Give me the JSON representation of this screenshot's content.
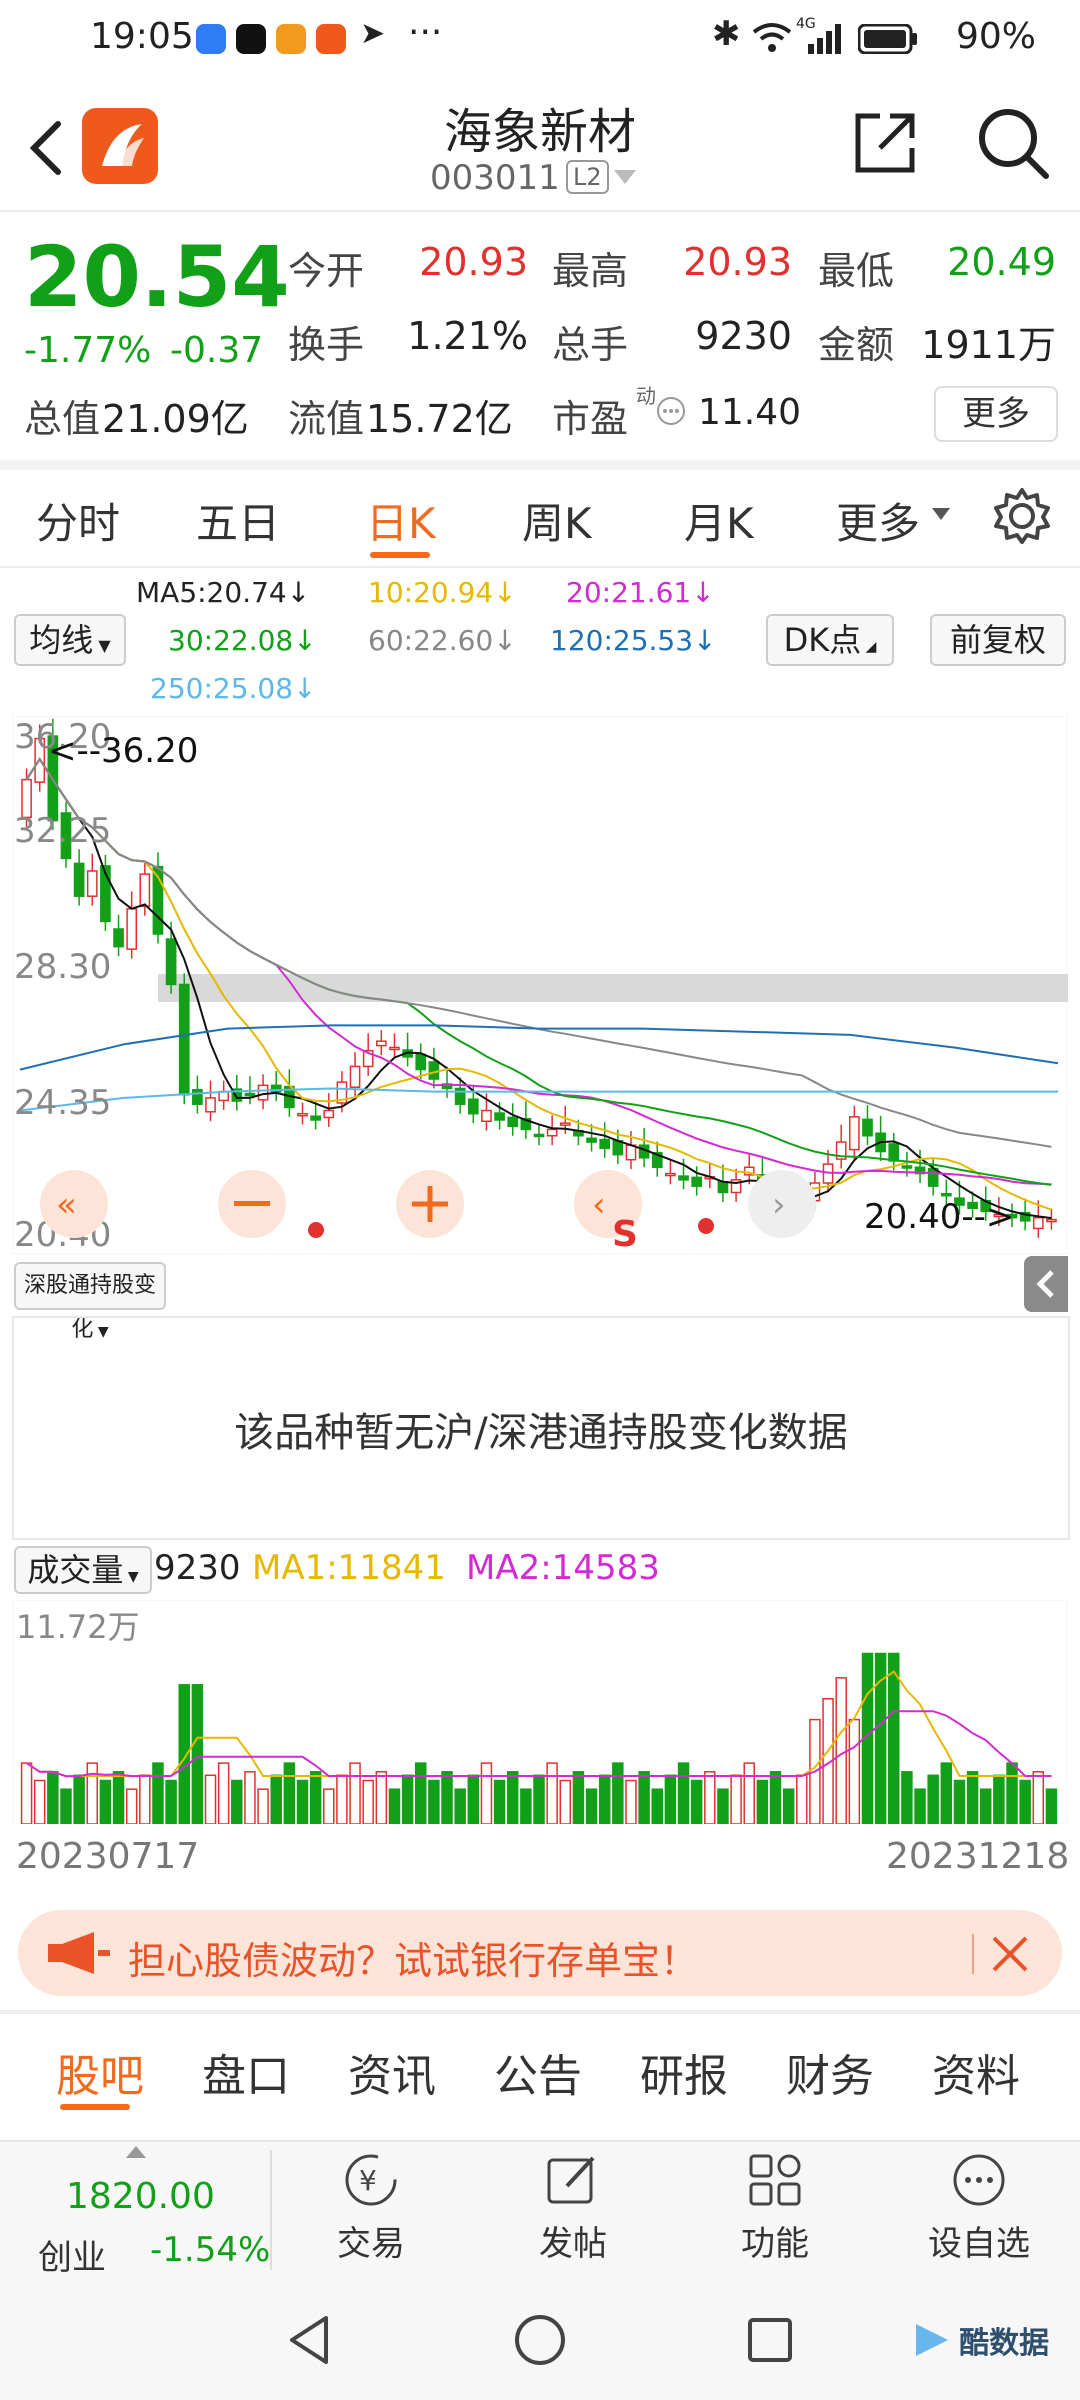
{
  "status_bar": {
    "time": "19:05",
    "more": "···",
    "net": "4G",
    "battery": "90%"
  },
  "header": {
    "title": "海象新材",
    "code": "003011",
    "level": "L2"
  },
  "quote": {
    "price": "20.54",
    "change_pct": "-1.77%",
    "change": "-0.37",
    "open_label": "今开",
    "open": "20.93",
    "high_label": "最高",
    "high": "20.93",
    "low_label": "最低",
    "low": "20.49",
    "turnover_label": "换手",
    "turnover": "1.21%",
    "volume_label": "总手",
    "volume": "9230",
    "amount_label": "金额",
    "amount": "1911万",
    "mktcap_label": "总值",
    "mktcap": "21.09亿",
    "float_label": "流值",
    "float": "15.72亿",
    "pe_label": "市盈",
    "pe_sup": "动",
    "pe": "11.40",
    "more_label": "更多"
  },
  "tabs": [
    "分时",
    "五日",
    "日K",
    "周K",
    "月K",
    "更多"
  ],
  "ma_bar": {
    "indicator": "均线",
    "ma5": "MA5:20.74↓",
    "ma10": "10:20.94↓",
    "ma20": "20:21.61↓",
    "ma30": "30:22.08↓",
    "ma60": "60:22.60↓",
    "ma120": "120:25.53↓",
    "ma250": "250:25.08↓",
    "dk": "DK点",
    "adjust": "前复权"
  },
  "kline": {
    "y_top": "36.20",
    "y_2": "32.25",
    "y_3": "28.30",
    "y_4": "24.35",
    "y_bottom": "20.40",
    "max_label": "<--36.20",
    "min_label": "20.40-->",
    "s_mark": "S"
  },
  "hk_panel": {
    "selector": "深股通持股变化",
    "empty_text": "该品种暂无沪/深港通持股变化数据"
  },
  "volume_bar": {
    "selector": "成交量",
    "value": "9230",
    "ma1": "MA1:11841",
    "ma2": "MA2:14583",
    "y_max": "11.72万"
  },
  "dates": {
    "start": "20230717",
    "end": "20231218"
  },
  "promo": {
    "text": "担心股债波动？试试银行存单宝！"
  },
  "bottom_tabs": [
    "股吧",
    "盘口",
    "资讯",
    "公告",
    "研报",
    "财务",
    "资料"
  ],
  "toolbar": {
    "index_value": "1820.00",
    "index_name": "创业",
    "index_change": "-1.54%",
    "trade": "交易",
    "post": "发帖",
    "func": "功能",
    "watch": "设自选"
  },
  "watermark": "酷数据",
  "colors": {
    "up": "#e0312f",
    "down": "#12a018",
    "accent": "#f06b1f"
  },
  "chart_data": {
    "type": "candlestick",
    "price_range": [
      20.4,
      36.2
    ],
    "bars": 110,
    "closes": [
      34.5,
      35.8,
      33.2,
      32.0,
      30.8,
      31.6,
      30.0,
      29.2,
      30.4,
      31.5,
      29.6,
      28.0,
      24.5,
      24.2,
      24.4,
      24.6,
      24.3,
      24.5,
      24.8,
      24.6,
      24.1,
      23.9,
      23.7,
      24.0,
      24.9,
      25.4,
      25.9,
      26.2,
      26.0,
      25.7,
      25.3,
      25.0,
      24.7,
      24.2,
      23.9,
      24.0,
      23.7,
      23.5,
      23.4,
      23.2,
      23.4,
      23.6,
      23.2,
      23.0,
      22.8,
      22.6,
      22.9,
      22.5,
      22.2,
      22.0,
      21.8,
      21.6,
      21.9,
      21.4,
      21.8,
      22.2,
      21.5,
      21.0,
      20.9,
      21.3,
      21.7,
      22.3,
      23.0,
      23.8,
      23.2,
      22.7,
      22.4,
      22.2,
      22.0,
      21.6,
      21.3,
      21.0,
      20.9,
      20.8,
      20.7,
      20.6,
      20.5,
      20.6,
      20.54
    ],
    "ma_lines": [
      "MA5",
      "MA10",
      "MA20",
      "MA30",
      "MA60",
      "MA120",
      "MA250"
    ],
    "volume_max": "11.72万"
  }
}
